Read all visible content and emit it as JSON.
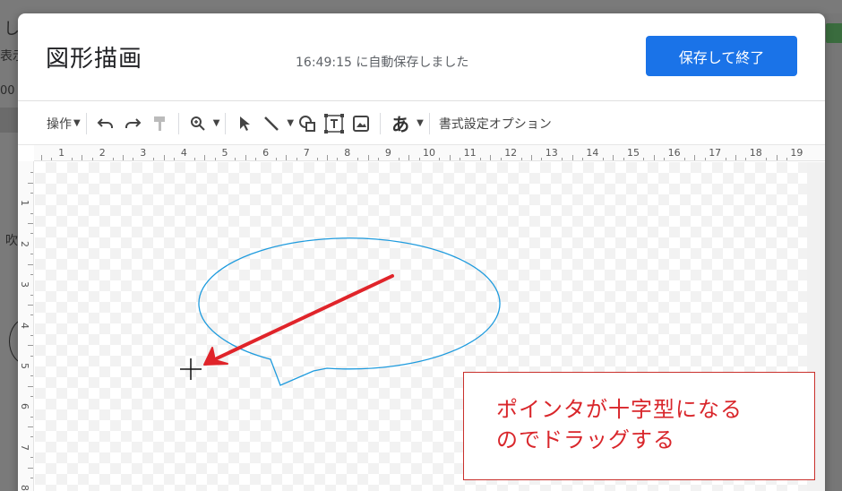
{
  "background": {
    "frag_title": "し",
    "frag_menu": "表示",
    "frag_zoom": "00",
    "frag_side": "吹"
  },
  "dialog": {
    "title": "図形描画",
    "autosave": "16:49:15 に自動保存しました",
    "save_button": "保存して終了"
  },
  "toolbar": {
    "actions_label": "操作",
    "text_style_glyph": "あ",
    "format_options": "書式設定オプション",
    "icons": [
      "undo-icon",
      "redo-icon",
      "paint-format-icon",
      "zoom-icon",
      "select-icon",
      "line-icon",
      "shape-icon",
      "textbox-icon",
      "image-icon"
    ]
  },
  "ruler": {
    "top_numbers": [
      "1",
      "2",
      "3",
      "4",
      "5",
      "6",
      "7",
      "8",
      "9",
      "10",
      "11",
      "12",
      "13",
      "14",
      "15",
      "16",
      "17",
      "18",
      "19"
    ],
    "left_numbers": [
      "1",
      "2",
      "3",
      "4",
      "5",
      "6",
      "7",
      "8"
    ]
  },
  "annotation": {
    "line1": "ポインタが十字型になる",
    "line2": "のでドラッグする"
  },
  "colors": {
    "accent": "#1a73e8",
    "callout_stroke": "#1e9bde",
    "arrow": "#e0242a",
    "annotation_text": "#d9262b"
  }
}
